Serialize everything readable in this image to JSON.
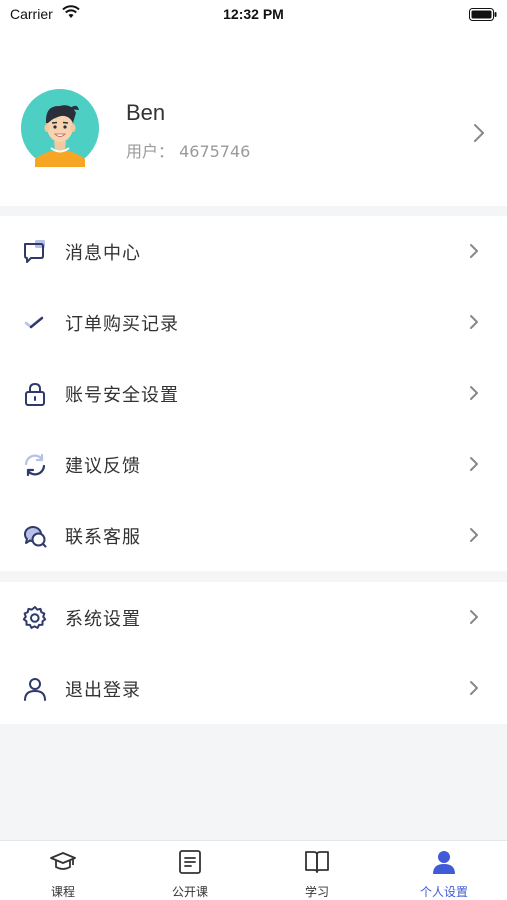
{
  "status_bar": {
    "carrier": "Carrier",
    "time": "12:32 PM"
  },
  "profile": {
    "name": "Ben",
    "user_id": "用户：  4675746"
  },
  "menu_group_1": [
    {
      "label": "消息中心",
      "icon": "message-icon"
    },
    {
      "label": "订单购买记录",
      "icon": "check-icon"
    },
    {
      "label": "账号安全设置",
      "icon": "lock-icon"
    },
    {
      "label": "建议反馈",
      "icon": "refresh-icon"
    },
    {
      "label": "联系客服",
      "icon": "chat-bubbles-icon"
    }
  ],
  "menu_group_2": [
    {
      "label": "系统设置",
      "icon": "gear-icon"
    },
    {
      "label": "退出登录",
      "icon": "person-icon"
    }
  ],
  "tabbar": {
    "items": [
      {
        "label": "课程",
        "icon": "graduation-cap-icon"
      },
      {
        "label": "公开课",
        "icon": "document-icon"
      },
      {
        "label": "学习",
        "icon": "book-icon"
      },
      {
        "label": "个人设置",
        "icon": "user-icon",
        "active": true
      }
    ]
  },
  "colors": {
    "accent": "#3f5bd6",
    "icon": "#2f3a6b",
    "background": "#f4f5f7"
  }
}
